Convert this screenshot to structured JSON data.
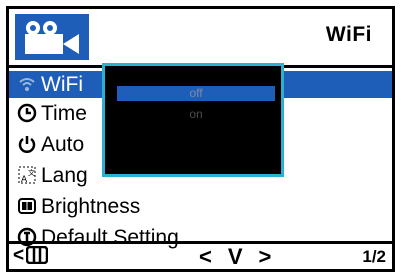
{
  "header": {
    "title": "WiFi"
  },
  "menu": {
    "items": [
      {
        "label": "WiFi",
        "icon": "wifi-icon"
      },
      {
        "label": "Time",
        "icon": "clock-icon"
      },
      {
        "label": "Auto",
        "icon": "power-icon"
      },
      {
        "label": "Lang",
        "icon": "language-icon"
      },
      {
        "label": "Brightness",
        "icon": "brightness-icon"
      },
      {
        "label": "Default Setting",
        "icon": "reset-icon"
      }
    ]
  },
  "popup": {
    "options": [
      "off",
      "on"
    ],
    "selected": "off"
  },
  "footer": {
    "back": "<",
    "prev": "<",
    "down": "V",
    "next": ">",
    "page": "1/2"
  },
  "colors": {
    "accent": "#1f5eb8",
    "popup_border": "#2ab0d0"
  }
}
